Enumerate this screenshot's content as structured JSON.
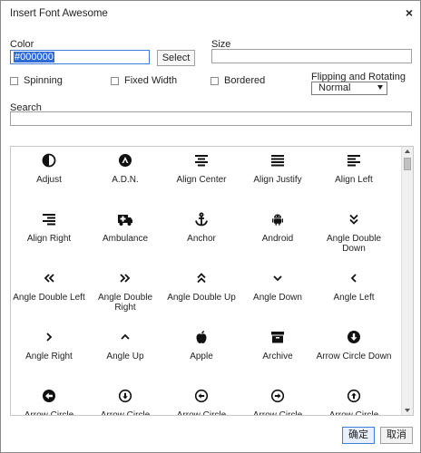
{
  "dialog": {
    "title": "Insert Font Awesome",
    "close_icon_glyph": "×"
  },
  "color": {
    "label": "Color",
    "value": "#000000",
    "select_label": "Select"
  },
  "size": {
    "label": "Size",
    "value": ""
  },
  "options": {
    "spinning": "Spinning",
    "fixed_width": "Fixed Width",
    "bordered": "Bordered"
  },
  "flip": {
    "label": "Flipping and Rotating",
    "selected": "Normal"
  },
  "search": {
    "label": "Search",
    "value": ""
  },
  "icons": [
    {
      "name": "Adjust",
      "icon": "adjust-icon"
    },
    {
      "name": "A.D.N.",
      "icon": "adn-icon"
    },
    {
      "name": "Align Center",
      "icon": "align-center-icon"
    },
    {
      "name": "Align Justify",
      "icon": "align-justify-icon"
    },
    {
      "name": "Align Left",
      "icon": "align-left-icon"
    },
    {
      "name": "Align Right",
      "icon": "align-right-icon"
    },
    {
      "name": "Ambulance",
      "icon": "ambulance-icon"
    },
    {
      "name": "Anchor",
      "icon": "anchor-icon"
    },
    {
      "name": "Android",
      "icon": "android-icon"
    },
    {
      "name": "Angle Double Down",
      "icon": "angle-double-down-icon"
    },
    {
      "name": "Angle Double Left",
      "icon": "angle-double-left-icon"
    },
    {
      "name": "Angle Double Right",
      "icon": "angle-double-right-icon"
    },
    {
      "name": "Angle Double Up",
      "icon": "angle-double-up-icon"
    },
    {
      "name": "Angle Down",
      "icon": "angle-down-icon"
    },
    {
      "name": "Angle Left",
      "icon": "angle-left-icon"
    },
    {
      "name": "Angle Right",
      "icon": "angle-right-icon"
    },
    {
      "name": "Angle Up",
      "icon": "angle-up-icon"
    },
    {
      "name": "Apple",
      "icon": "apple-icon"
    },
    {
      "name": "Archive",
      "icon": "archive-icon"
    },
    {
      "name": "Arrow Circle Down",
      "icon": "arrow-circle-down-icon"
    },
    {
      "name": "Arrow Circle",
      "icon": "arrow-circle-left-icon"
    },
    {
      "name": "Arrow Circle",
      "icon": "arrow-circle-o-down-icon"
    },
    {
      "name": "Arrow Circle",
      "icon": "arrow-circle-o-left-icon"
    },
    {
      "name": "Arrow Circle",
      "icon": "arrow-circle-o-right-icon"
    },
    {
      "name": "Arrow Circle",
      "icon": "arrow-circle-o-up-icon"
    }
  ],
  "footer": {
    "ok_label": "确定",
    "cancel_label": "取消"
  }
}
